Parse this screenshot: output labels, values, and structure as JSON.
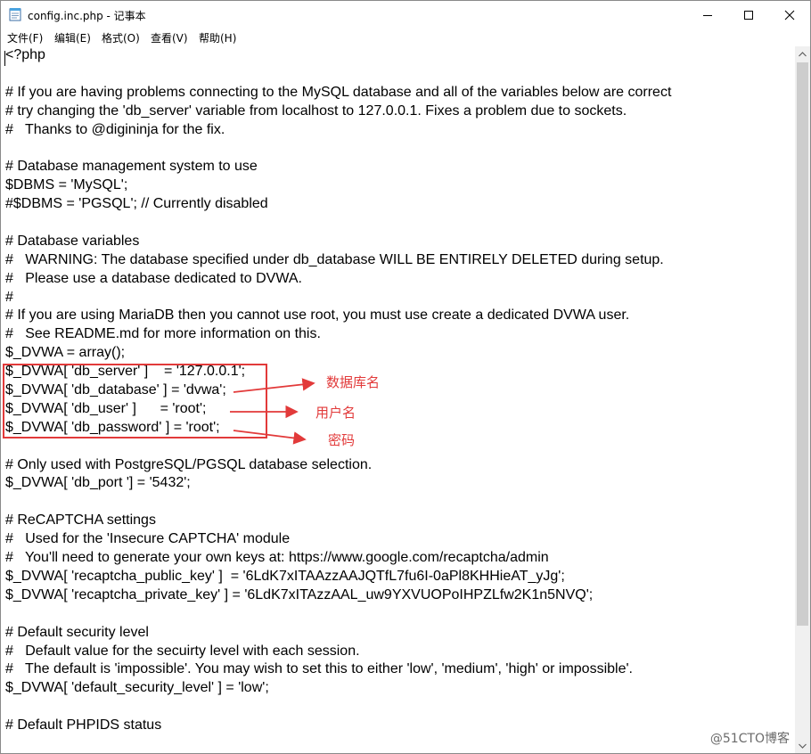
{
  "window": {
    "title": "config.inc.php - 记事本",
    "controls": {
      "minimize": "minimize",
      "maximize": "maximize",
      "close": "close"
    }
  },
  "menu": [
    "文件(F)",
    "编辑(E)",
    "格式(O)",
    "查看(V)",
    "帮助(H)"
  ],
  "editor": {
    "lines": [
      "<?php",
      "",
      "# If you are having problems connecting to the MySQL database and all of the variables below are correct",
      "# try changing the 'db_server' variable from localhost to 127.0.0.1. Fixes a problem due to sockets.",
      "#   Thanks to @digininja for the fix.",
      "",
      "# Database management system to use",
      "$DBMS = 'MySQL';",
      "#$DBMS = 'PGSQL'; // Currently disabled",
      "",
      "# Database variables",
      "#   WARNING: The database specified under db_database WILL BE ENTIRELY DELETED during setup.",
      "#   Please use a database dedicated to DVWA.",
      "#",
      "# If you are using MariaDB then you cannot use root, you must use create a dedicated DVWA user.",
      "#   See README.md for more information on this.",
      "$_DVWA = array();",
      "$_DVWA[ 'db_server' ]    = '127.0.0.1';",
      "$_DVWA[ 'db_database' ] = 'dvwa';",
      "$_DVWA[ 'db_user' ]      = 'root';",
      "$_DVWA[ 'db_password' ] = 'root';",
      "",
      "# Only used with PostgreSQL/PGSQL database selection.",
      "$_DVWA[ 'db_port '] = '5432';",
      "",
      "# ReCAPTCHA settings",
      "#   Used for the 'Insecure CAPTCHA' module",
      "#   You'll need to generate your own keys at: https://www.google.com/recaptcha/admin",
      "$_DVWA[ 'recaptcha_public_key' ]  = '6LdK7xITAAzzAAJQTfL7fu6I-0aPl8KHHieAT_yJg';",
      "$_DVWA[ 'recaptcha_private_key' ] = '6LdK7xITAzzAAL_uw9YXVUOPoIHPZLfw2K1n5NVQ';",
      "",
      "# Default security level",
      "#   Default value for the secuirty level with each session.",
      "#   The default is 'impossible'. You may wish to set this to either 'low', 'medium', 'high' or impossible'.",
      "$_DVWA[ 'default_security_level' ] = 'low';",
      "",
      "# Default PHPIDS status"
    ]
  },
  "annotations": {
    "db_name": "数据库名",
    "user_name": "用户名",
    "password": "密码",
    "color": "#e23a3a"
  },
  "watermark": "@51CTO博客"
}
